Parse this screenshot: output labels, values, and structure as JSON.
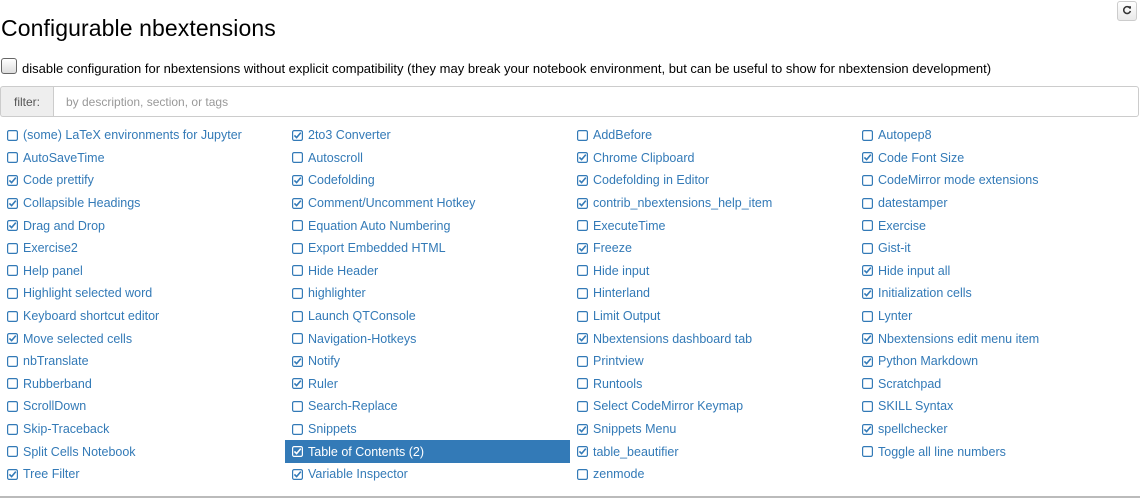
{
  "page": {
    "title": "Configurable nbextensions",
    "disable_config_label": "disable configuration for nbextensions without explicit compatibility (they may break your notebook environment, but can be useful to show for nbextension development)",
    "disable_config_checked": false
  },
  "filter": {
    "label": "filter:",
    "placeholder": "by description, section, or tags",
    "value": ""
  },
  "colors": {
    "link": "#337ab7",
    "selected_bg": "#337ab7"
  },
  "extensions": [
    {
      "label": "(some) LaTeX environments for Jupyter",
      "enabled": false
    },
    {
      "label": "2to3 Converter",
      "enabled": true
    },
    {
      "label": "AddBefore",
      "enabled": false
    },
    {
      "label": "Autopep8",
      "enabled": false
    },
    {
      "label": "AutoSaveTime",
      "enabled": false
    },
    {
      "label": "Autoscroll",
      "enabled": false
    },
    {
      "label": "Chrome Clipboard",
      "enabled": true
    },
    {
      "label": "Code Font Size",
      "enabled": true
    },
    {
      "label": "Code prettify",
      "enabled": true
    },
    {
      "label": "Codefolding",
      "enabled": true
    },
    {
      "label": "Codefolding in Editor",
      "enabled": true
    },
    {
      "label": "CodeMirror mode extensions",
      "enabled": false
    },
    {
      "label": "Collapsible Headings",
      "enabled": true
    },
    {
      "label": "Comment/Uncomment Hotkey",
      "enabled": true
    },
    {
      "label": "contrib_nbextensions_help_item",
      "enabled": true
    },
    {
      "label": "datestamper",
      "enabled": false
    },
    {
      "label": "Drag and Drop",
      "enabled": true
    },
    {
      "label": "Equation Auto Numbering",
      "enabled": false
    },
    {
      "label": "ExecuteTime",
      "enabled": false
    },
    {
      "label": "Exercise",
      "enabled": false
    },
    {
      "label": "Exercise2",
      "enabled": false
    },
    {
      "label": "Export Embedded HTML",
      "enabled": false
    },
    {
      "label": "Freeze",
      "enabled": true
    },
    {
      "label": "Gist-it",
      "enabled": false
    },
    {
      "label": "Help panel",
      "enabled": false
    },
    {
      "label": "Hide Header",
      "enabled": false
    },
    {
      "label": "Hide input",
      "enabled": false
    },
    {
      "label": "Hide input all",
      "enabled": true
    },
    {
      "label": "Highlight selected word",
      "enabled": false
    },
    {
      "label": "highlighter",
      "enabled": false
    },
    {
      "label": "Hinterland",
      "enabled": false
    },
    {
      "label": "Initialization cells",
      "enabled": true
    },
    {
      "label": "Keyboard shortcut editor",
      "enabled": false
    },
    {
      "label": "Launch QTConsole",
      "enabled": false
    },
    {
      "label": "Limit Output",
      "enabled": false
    },
    {
      "label": "Lynter",
      "enabled": false
    },
    {
      "label": "Move selected cells",
      "enabled": true
    },
    {
      "label": "Navigation-Hotkeys",
      "enabled": false
    },
    {
      "label": "Nbextensions dashboard tab",
      "enabled": true
    },
    {
      "label": "Nbextensions edit menu item",
      "enabled": true
    },
    {
      "label": "nbTranslate",
      "enabled": false
    },
    {
      "label": "Notify",
      "enabled": true
    },
    {
      "label": "Printview",
      "enabled": false
    },
    {
      "label": "Python Markdown",
      "enabled": true
    },
    {
      "label": "Rubberband",
      "enabled": false
    },
    {
      "label": "Ruler",
      "enabled": true
    },
    {
      "label": "Runtools",
      "enabled": false
    },
    {
      "label": "Scratchpad",
      "enabled": false
    },
    {
      "label": "ScrollDown",
      "enabled": false
    },
    {
      "label": "Search-Replace",
      "enabled": false
    },
    {
      "label": "Select CodeMirror Keymap",
      "enabled": false
    },
    {
      "label": "SKILL Syntax",
      "enabled": false
    },
    {
      "label": "Skip-Traceback",
      "enabled": false
    },
    {
      "label": "Snippets",
      "enabled": false
    },
    {
      "label": "Snippets Menu",
      "enabled": true
    },
    {
      "label": "spellchecker",
      "enabled": true
    },
    {
      "label": "Split Cells Notebook",
      "enabled": false
    },
    {
      "label": "Table of Contents (2)",
      "enabled": true,
      "selected": true
    },
    {
      "label": "table_beautifier",
      "enabled": true
    },
    {
      "label": "Toggle all line numbers",
      "enabled": false
    },
    {
      "label": "Tree Filter",
      "enabled": true
    },
    {
      "label": "Variable Inspector",
      "enabled": true
    },
    {
      "label": "zenmode",
      "enabled": false
    }
  ]
}
